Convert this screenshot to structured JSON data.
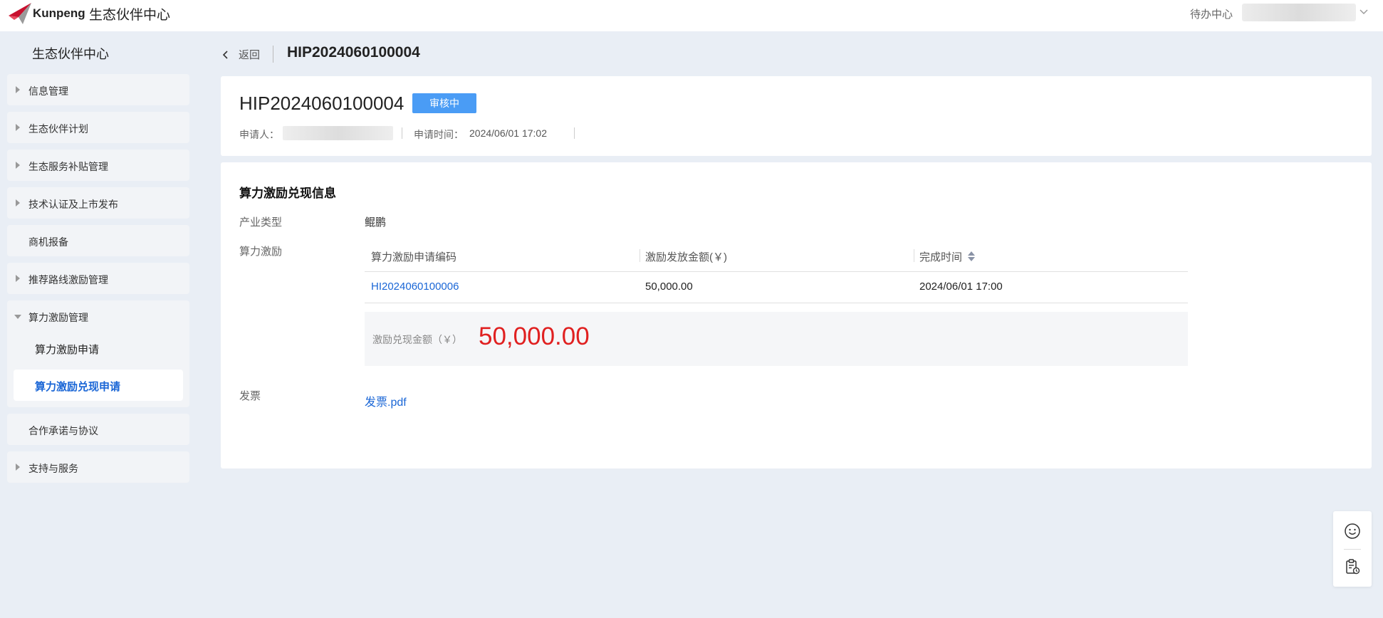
{
  "header": {
    "brand": "Kunpeng",
    "title": "生态伙伴中心",
    "todo": "待办中心"
  },
  "sidebar": {
    "title": "生态伙伴中心",
    "items": [
      {
        "label": "信息管理",
        "expandable": true
      },
      {
        "label": "生态伙伴计划",
        "expandable": true
      },
      {
        "label": "生态服务补贴管理",
        "expandable": true
      },
      {
        "label": "技术认证及上市发布",
        "expandable": true
      },
      {
        "label": "商机报备",
        "expandable": false
      },
      {
        "label": "推荐路线激励管理",
        "expandable": true
      },
      {
        "label": "算力激励管理",
        "expanded": true,
        "children": [
          "算力激励申请",
          "算力激励兑现申请"
        ],
        "active_child": "算力激励兑现申请"
      },
      {
        "label": "合作承诺与协议",
        "expandable": false
      },
      {
        "label": "支持与服务",
        "expandable": true
      }
    ]
  },
  "breadcrumb": {
    "back": "返回",
    "title": "HIP2024060100004"
  },
  "summary": {
    "id": "HIP2024060100004",
    "status": "审核中",
    "applicant_label": "申请人：",
    "time_label": "申请时间：",
    "time": "2024/06/01 17:02"
  },
  "detail": {
    "section_title": "算力激励兑现信息",
    "industry_label": "产业类型",
    "industry_value": "鲲鹏",
    "incentive_label": "算力激励",
    "table": {
      "columns": [
        "算力激励申请编码",
        "激励发放金额(￥)",
        "完成时间"
      ],
      "rows": [
        {
          "code": "HI2024060100006",
          "amount": "50,000.00",
          "time": "2024/06/01 17:00"
        }
      ]
    },
    "total_label": "激励兑现金额（￥）",
    "total_value": "50,000.00",
    "invoice_label": "发票",
    "invoice_file": "发票.pdf"
  },
  "colors": {
    "accent": "#1a66d6",
    "badge": "#4a9cf5",
    "amount": "#e02020",
    "background": "#e9eef5"
  },
  "icons": [
    "kunpeng-logo-icon",
    "chevron-down-icon",
    "back-arrow-icon",
    "sort-icon",
    "smile-icon",
    "clipboard-icon"
  ]
}
